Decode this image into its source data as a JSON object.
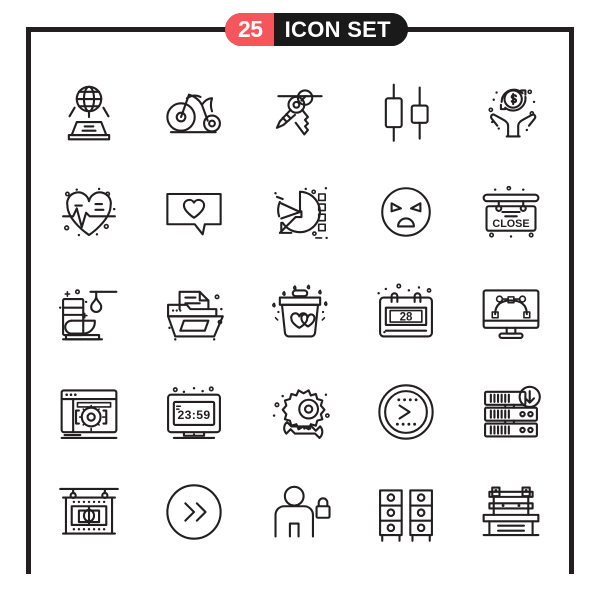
{
  "header": {
    "count": "25",
    "title": "ICON SET"
  },
  "frame": {
    "border_color": "#231f20",
    "accent_color": "#f4565b",
    "badge_bg": "#1a1a1a",
    "icon_stroke": "#231f20",
    "background": "#ffffff"
  },
  "grid": {
    "columns": 5,
    "rows": 5,
    "total": 25
  },
  "icons": [
    {
      "id": 1,
      "name": "globe-hologram-projector-icon",
      "row": 1,
      "col": 1
    },
    {
      "id": 2,
      "name": "bicycle-icon",
      "row": 1,
      "col": 2
    },
    {
      "id": 3,
      "name": "keys-icon",
      "row": 1,
      "col": 3
    },
    {
      "id": 4,
      "name": "candlestick-chart-icon",
      "row": 1,
      "col": 4
    },
    {
      "id": 5,
      "name": "money-in-hands-icon",
      "row": 1,
      "col": 5
    },
    {
      "id": 6,
      "name": "heartbeat-pulse-icon",
      "row": 2,
      "col": 1
    },
    {
      "id": 7,
      "name": "love-chat-message-icon",
      "row": 2,
      "col": 2
    },
    {
      "id": 8,
      "name": "pie-chart-icon",
      "row": 2,
      "col": 3
    },
    {
      "id": 9,
      "name": "angry-emoji-icon",
      "row": 2,
      "col": 4
    },
    {
      "id": 10,
      "name": "close-sign-icon",
      "row": 2,
      "col": 5,
      "label": "CLOSE"
    },
    {
      "id": 11,
      "name": "bathroom-cleaning-icon",
      "row": 3,
      "col": 1
    },
    {
      "id": 12,
      "name": "file-folder-document-icon",
      "row": 3,
      "col": 2
    },
    {
      "id": 13,
      "name": "gift-bucket-hearts-icon",
      "row": 3,
      "col": 3
    },
    {
      "id": 14,
      "name": "calendar-icon",
      "row": 3,
      "col": 4,
      "label": "28"
    },
    {
      "id": 15,
      "name": "monitor-bezier-curve-icon",
      "row": 3,
      "col": 5
    },
    {
      "id": 16,
      "name": "browser-settings-gear-icon",
      "row": 4,
      "col": 1
    },
    {
      "id": 17,
      "name": "digital-clock-icon",
      "row": 4,
      "col": 2,
      "label": "23:59"
    },
    {
      "id": 18,
      "name": "gear-wrench-tools-icon",
      "row": 4,
      "col": 3
    },
    {
      "id": 19,
      "name": "command-prompt-icon",
      "row": 4,
      "col": 4
    },
    {
      "id": 20,
      "name": "server-download-icon",
      "row": 4,
      "col": 5
    },
    {
      "id": 21,
      "name": "hanging-signboard-icon",
      "row": 5,
      "col": 1
    },
    {
      "id": 22,
      "name": "fast-forward-circle-icon",
      "row": 5,
      "col": 2
    },
    {
      "id": 23,
      "name": "user-lock-security-icon",
      "row": 5,
      "col": 3
    },
    {
      "id": 24,
      "name": "filing-cabinet-drawers-icon",
      "row": 5,
      "col": 4
    },
    {
      "id": 25,
      "name": "park-bench-icon",
      "row": 5,
      "col": 5
    }
  ]
}
